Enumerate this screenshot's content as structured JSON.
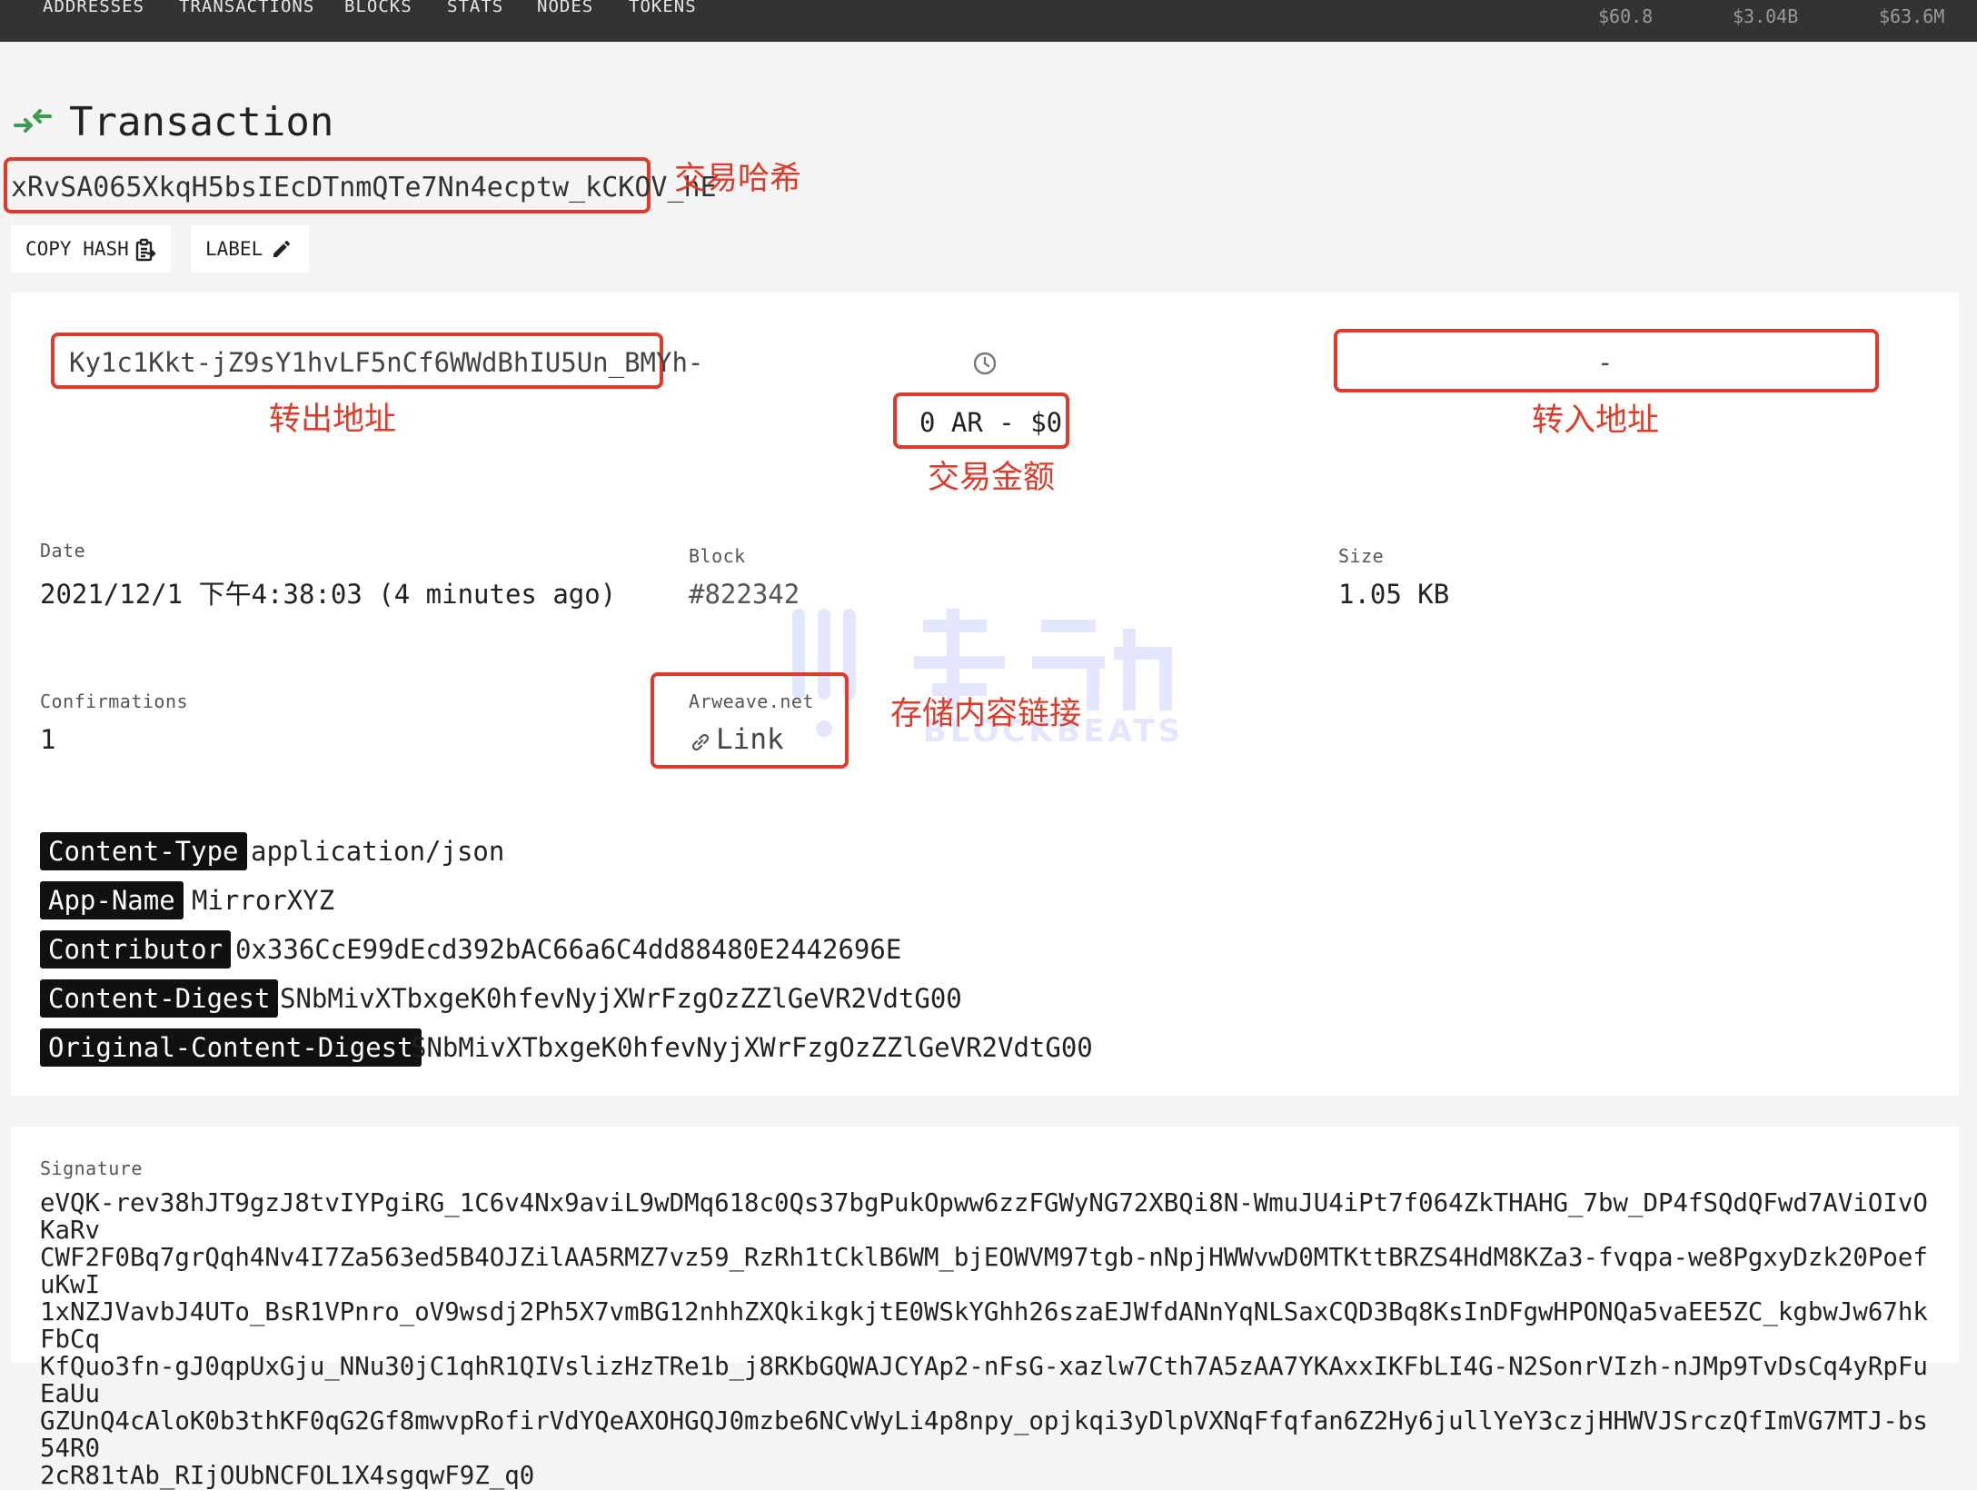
{
  "nav": {
    "items": [
      "ADDRESSES",
      "TRANSACTIONS",
      "BLOCKS",
      "STATS",
      "NODES",
      "TOKENS"
    ],
    "prices": [
      "$60.8",
      "$3.04B",
      "$63.6M"
    ]
  },
  "header": {
    "title": "Transaction",
    "hash": "xRvSA065XkqH5bsIEcDTnmQTe7Nn4ecptw_kCKOV_hE",
    "copy_hash_label": "COPY HASH",
    "label_button": "LABEL"
  },
  "annotations": {
    "tx_hash": "交易哈希",
    "from_address": "转出地址",
    "to_address": "转入地址",
    "amount": "交易金额",
    "storage_link": "存储内容链接"
  },
  "transfer": {
    "from": "Ky1c1Kkt-jZ9sY1hvLF5nCf6WWdBhIU5Un_BMYh-",
    "amount": "0 AR - $0",
    "to": "-"
  },
  "details": {
    "date_label": "Date",
    "date_value": "2021/12/1 下午4:38:03 (4 minutes ago)",
    "block_label": "Block",
    "block_value": "#822342",
    "size_label": "Size",
    "size_value": "1.05 KB",
    "confirmations_label": "Confirmations",
    "confirmations_value": "1",
    "arweave_label": "Arweave.net",
    "arweave_link": "Link"
  },
  "tags": [
    {
      "key": "Content-Type",
      "value": "application/json"
    },
    {
      "key": "App-Name",
      "value": "MirrorXYZ"
    },
    {
      "key": "Contributor",
      "value": "0x336CcE99dEcd392bAC66a6C4dd88480E2442696E"
    },
    {
      "key": "Content-Digest",
      "value": "SNbMivXTbxgeK0hfevNyjXWrFzgOzZZlGeVR2VdtG00"
    },
    {
      "key": "Original-Content-Digest",
      "value": "SNbMivXTbxgeK0hfevNyjXWrFzgOzZZlGeVR2VdtG00"
    }
  ],
  "signature": {
    "label": "Signature",
    "value": "eVQK-rev38hJT9gzJ8tvIYPgiRG_1C6v4Nx9aviL9wDMq618c0Qs37bgPukOpww6zzFGWyNG72XBQi8N-WmuJU4iPt7f064ZkTHAHG_7bw_DP4fSQdQFwd7AViOIvOKaRv\nCWF2F0Bq7grQqh4Nv4I7Za563ed5B4OJZilAA5RMZ7vz59_RzRh1tCklB6WM_bjEOWVM97tgb-nNpjHWWvwD0MTKttBRZS4HdM8KZa3-fvqpa-we8PgxyDzk20PoefuKwI\n1xNZJVavbJ4UTo_BsR1VPnro_oV9wsdj2Ph5X7vmBG12nhhZXQkikgkjtE0WSkYGhh26szaEJWfdANnYqNLSaxCQD3Bq8KsInDFgwHPONQa5vaEE5ZC_kgbwJw67hkFbCq\nKfQuo3fn-gJ0qpUxGju_NNu30jC1qhR1QIVslizHzTRe1b_j8RKbGQWAJCYAp2-nFsG-xazlw7Cth7A5zAA7YKAxxIKFbLI4G-N2SonrVIzh-nJMp9TvDsCq4yRpFuEaUu\nGZUnQ4cAloK0b3thKF0qG2Gf8mwvpRofirVdYQeAXOHGQJ0mzbe6NCvWyLi4p8npy_opjkqi3yDlpVXNqFfqfan6Z2Hy6jullYeY3czjHHWVJSrczQfImVG7MTJ-bs54R0\n2cR81tAb_RIjOUbNCFOL1X4sgqwF9Z_q0"
  },
  "watermark_text": "BLOCKBEATS",
  "colors": {
    "accent_red": "#e03a2a",
    "nav_bg": "#333333",
    "title_icon_green": "#3f9a54"
  }
}
